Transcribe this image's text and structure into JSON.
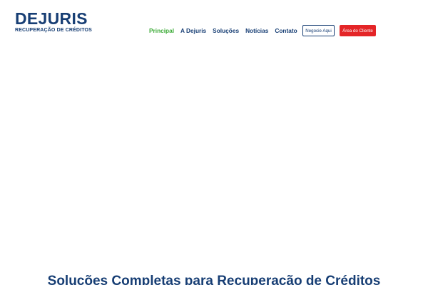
{
  "brand": {
    "name": "DEJURIS",
    "tagline": "RECUPERAÇÃO DE CRÉDITOS"
  },
  "nav": {
    "items": [
      {
        "label": "Principal",
        "active": true
      },
      {
        "label": "A Dejuris",
        "active": false
      },
      {
        "label": "Soluções",
        "active": false
      },
      {
        "label": "Notícias",
        "active": false
      },
      {
        "label": "Contato",
        "active": false
      }
    ]
  },
  "actions": {
    "negotiate_label": "Negocie Aqui",
    "client_area_label": "Área do Cliente"
  },
  "main": {
    "section_title": "Soluções Completas para Recuperação de Créditos"
  },
  "colors": {
    "brand_navy": "#173e74",
    "active_green": "#3aaa35",
    "accent_red": "#e42527",
    "background": "#ffffff"
  }
}
